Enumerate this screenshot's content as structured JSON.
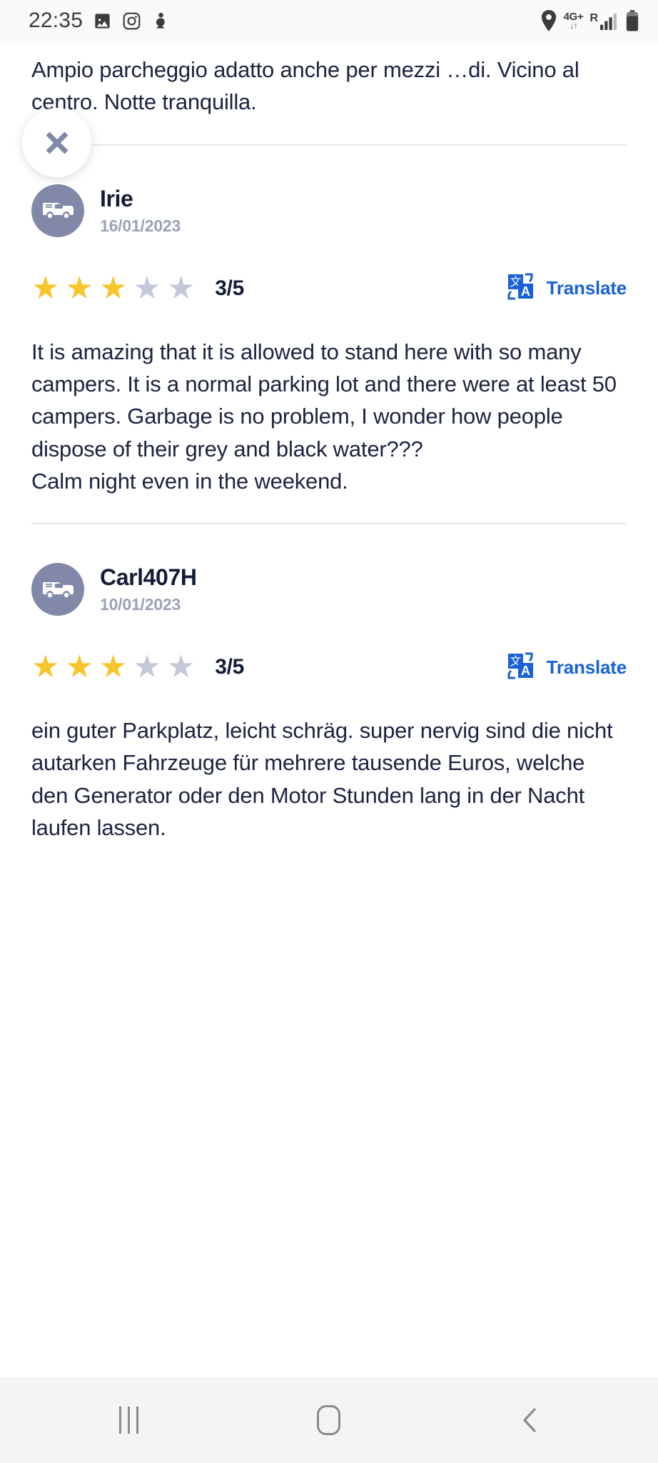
{
  "status_bar": {
    "clock": "22:35",
    "left_icons": [
      "gallery-icon",
      "instagram-icon",
      "app-icon"
    ],
    "network_label": "4G+",
    "network_arrows": "↓↑",
    "roaming_label": "R",
    "right_icons": [
      "location-pin-icon",
      "mobile-data-icon",
      "signal-bars-icon",
      "battery-icon"
    ]
  },
  "close_button": {
    "glyph": "✕",
    "name": "close"
  },
  "intro": {
    "text": "Ampio parcheggio adatto anche per mezzi …di. Vicino al centro.  Notte tranquilla."
  },
  "reviews": [
    {
      "author": "Irie",
      "date": "16/01/2023",
      "avatar_icon": "camper-van-icon",
      "rating": 3,
      "rating_max": 5,
      "rating_text": "3/5",
      "translate_label": "Translate",
      "translate_icon": "google-translate-icon",
      "body": "It is amazing that it is allowed to stand here with so many campers. It is a normal parking lot and there were at least 50 campers. Garbage is no problem, I wonder how people dispose of their grey and black water???\nCalm night even in the weekend."
    },
    {
      "author": "Carl407H",
      "date": "10/01/2023",
      "avatar_icon": "camper-van-icon",
      "rating": 3,
      "rating_max": 5,
      "rating_text": "3/5",
      "translate_label": "Translate",
      "translate_icon": "google-translate-icon",
      "body": "ein guter Parkplatz, leicht schräg. super nervig sind die nicht autarken Fahrzeuge für mehrere tausende Euros, welche den Generator oder den Motor Stunden lang in der Nacht laufen lassen."
    }
  ],
  "nav_bar": {
    "recents_label": "recents-button",
    "home_label": "home-button",
    "back_label": "back-button",
    "back_glyph": "‹"
  },
  "colors": {
    "star_filled": "#f7c52b",
    "star_empty": "#c3c8d8",
    "translate_blue": "#1a61d8",
    "avatar_bg": "#8289a8",
    "text_dark": "#1c2340",
    "date_gray": "#9aa2b6"
  }
}
